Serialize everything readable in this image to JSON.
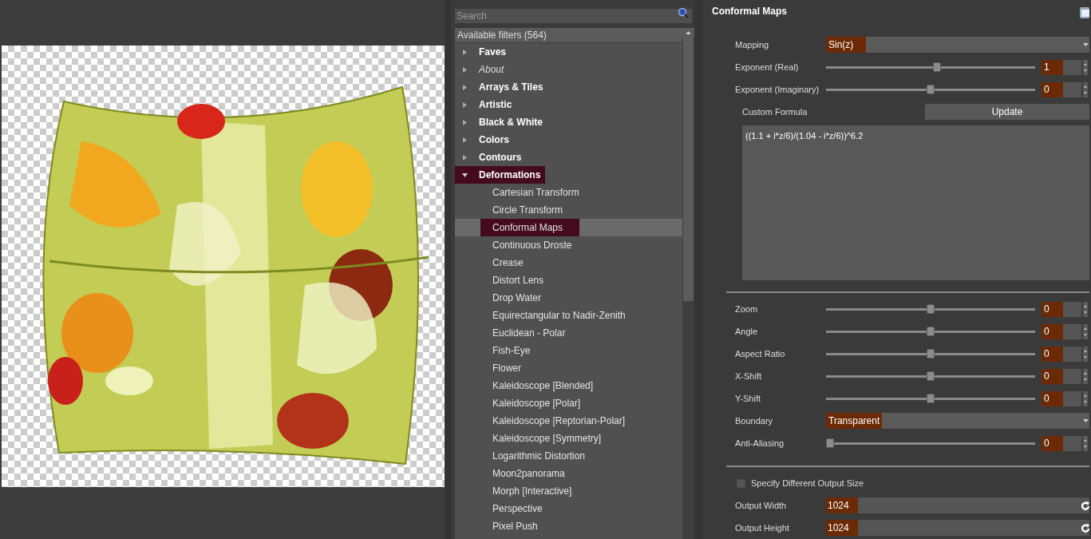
{
  "search": {
    "placeholder": "Search"
  },
  "filter_list": {
    "header": "Available filters (564)",
    "items": [
      {
        "label": "Faves",
        "kind": "category",
        "expanded": false,
        "selected": false
      },
      {
        "label": "About",
        "kind": "info",
        "expanded": false,
        "selected": false
      },
      {
        "label": "Arrays & Tiles",
        "kind": "category",
        "expanded": false,
        "selected": false
      },
      {
        "label": "Artistic",
        "kind": "category",
        "expanded": false,
        "selected": false
      },
      {
        "label": "Black & White",
        "kind": "category",
        "expanded": false,
        "selected": false
      },
      {
        "label": "Colors",
        "kind": "category",
        "expanded": false,
        "selected": false
      },
      {
        "label": "Contours",
        "kind": "category",
        "expanded": false,
        "selected": false
      },
      {
        "label": "Deformations",
        "kind": "category",
        "expanded": true,
        "selected": true,
        "children": [
          {
            "label": "Cartesian Transform",
            "selected": false
          },
          {
            "label": "Circle Transform",
            "selected": false
          },
          {
            "label": "Conformal Maps",
            "selected": true
          },
          {
            "label": "Continuous Droste",
            "selected": false
          },
          {
            "label": "Crease",
            "selected": false
          },
          {
            "label": "Distort Lens",
            "selected": false
          },
          {
            "label": "Drop Water",
            "selected": false
          },
          {
            "label": "Equirectangular to Nadir-Zenith",
            "selected": false
          },
          {
            "label": "Euclidean - Polar",
            "selected": false
          },
          {
            "label": "Fish-Eye",
            "selected": false
          },
          {
            "label": "Flower",
            "selected": false
          },
          {
            "label": "Kaleidoscope [Blended]",
            "selected": false
          },
          {
            "label": "Kaleidoscope [Polar]",
            "selected": false
          },
          {
            "label": "Kaleidoscope [Reptorian-Polar]",
            "selected": false
          },
          {
            "label": "Kaleidoscope [Symmetry]",
            "selected": false
          },
          {
            "label": "Logarithmic Distortion",
            "selected": false
          },
          {
            "label": "Moon2panorama",
            "selected": false
          },
          {
            "label": "Morph [Interactive]",
            "selected": false
          },
          {
            "label": "Perspective",
            "selected": false
          },
          {
            "label": "Pixel Push",
            "selected": false
          }
        ]
      }
    ]
  },
  "settings": {
    "title": "Conformal Maps",
    "groups": [
      {
        "rows": [
          {
            "kind": "dropdown",
            "label": "Mapping",
            "value": "Sin(z)"
          },
          {
            "kind": "slider",
            "label": "Exponent (Real)",
            "level": 0.53,
            "value": "1"
          },
          {
            "kind": "slider",
            "label": "Exponent (Imaginary)",
            "level": 0.5,
            "value": "0"
          },
          {
            "kind": "formula",
            "label": "Custom Formula",
            "button": "Update",
            "value": "((1.1 + i*z/6)/(1.04 - i*z/6))^6.2"
          }
        ]
      },
      {
        "rows": [
          {
            "kind": "slider",
            "label": "Zoom",
            "level": 0.5,
            "value": "0"
          },
          {
            "kind": "slider",
            "label": "Angle",
            "level": 0.5,
            "value": "0"
          },
          {
            "kind": "slider",
            "label": "Aspect Ratio",
            "level": 0.5,
            "value": "0"
          },
          {
            "kind": "slider",
            "label": "X-Shift",
            "level": 0.5,
            "value": "0"
          },
          {
            "kind": "slider",
            "label": "Y-Shift",
            "level": 0.5,
            "value": "0"
          },
          {
            "kind": "dropdown",
            "label": "Boundary",
            "value": "Transparent"
          },
          {
            "kind": "slider",
            "label": "Anti-Aliasing",
            "level": 0,
            "value": "0"
          }
        ]
      },
      {
        "rows": [
          {
            "kind": "checkbox",
            "label": "Specify Different Output Size",
            "checked": false
          },
          {
            "kind": "size",
            "label": "Output Width",
            "value": "1024"
          },
          {
            "kind": "size",
            "label": "Output Height",
            "value": "1024"
          }
        ]
      }
    ]
  }
}
